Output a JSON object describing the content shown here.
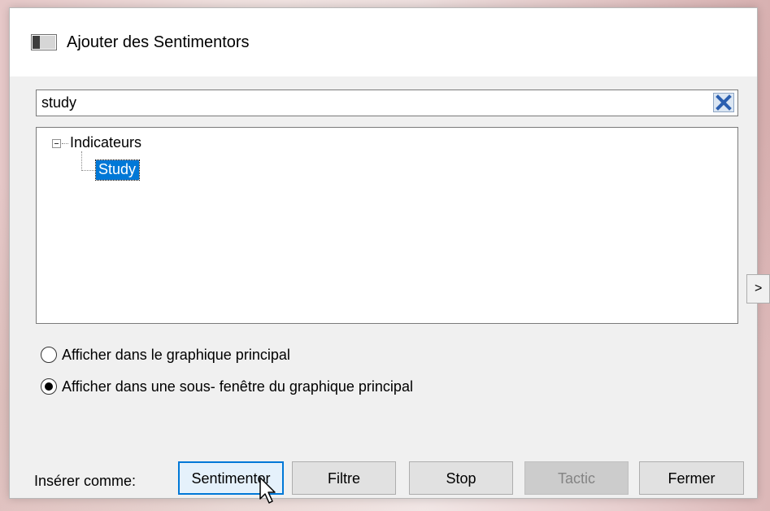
{
  "dialog": {
    "title": "Ajouter des Sentimentors"
  },
  "search": {
    "value": "study"
  },
  "tree": {
    "root_label": "Indicateurs",
    "child_label": "Study"
  },
  "side_arrow": ">",
  "radios": [
    {
      "label": "Afficher dans le graphique principal",
      "checked": false
    },
    {
      "label": "Afficher dans une sous- fenêtre du graphique principal",
      "checked": true
    }
  ],
  "footer": {
    "insert_label": "Insérer comme:",
    "buttons": [
      {
        "label": "Sentimentor",
        "state": "default"
      },
      {
        "label": "Filtre",
        "state": "normal"
      },
      {
        "label": "Stop",
        "state": "normal"
      },
      {
        "label": "Tactic",
        "state": "disabled"
      },
      {
        "label": "Fermer",
        "state": "normal"
      }
    ]
  },
  "colors": {
    "selection": "#0078d7",
    "clear_icon": "#2b5fb0",
    "dialog_bg": "#f0f0f0"
  },
  "icons": {
    "title": "window-icon",
    "clear": "clear-x-icon",
    "tree_toggle": "collapse-minus-icon",
    "cursor": "mouse-pointer-icon"
  }
}
